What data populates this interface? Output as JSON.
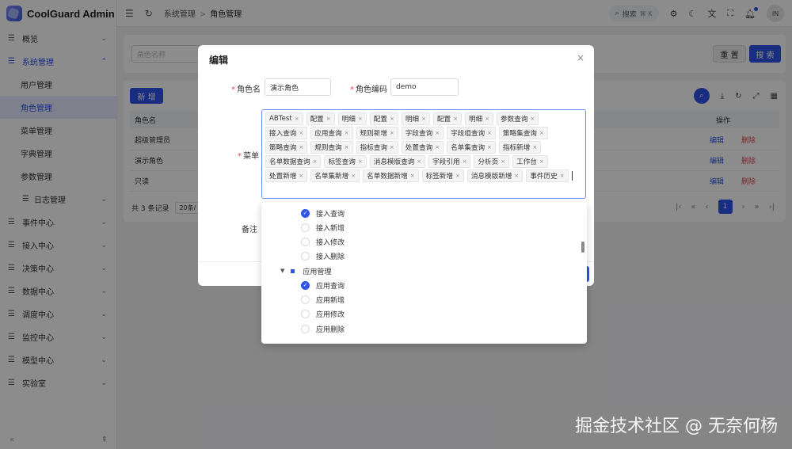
{
  "app": {
    "title": "CoolGuard Admin"
  },
  "sidebar": {
    "items": [
      {
        "label": "概览"
      },
      {
        "label": "系统管理",
        "open": true
      },
      {
        "label": "事件中心"
      },
      {
        "label": "接入中心"
      },
      {
        "label": "决策中心"
      },
      {
        "label": "数据中心"
      },
      {
        "label": "调度中心"
      },
      {
        "label": "监控中心"
      },
      {
        "label": "模型中心"
      },
      {
        "label": "实验室"
      }
    ],
    "sub_items": [
      {
        "label": "用户管理"
      },
      {
        "label": "角色管理",
        "active": true
      },
      {
        "label": "菜单管理"
      },
      {
        "label": "字典管理"
      },
      {
        "label": "参数管理"
      },
      {
        "label": "日志管理"
      }
    ],
    "foot_left": "«",
    "foot_right": "⇞"
  },
  "topbar": {
    "crumb_parent": "系统管理",
    "crumb_sep": ">",
    "crumb_current": "角色管理",
    "search_label": "搜索",
    "search_kbd": "⌘ K",
    "user_initials": "IN"
  },
  "filter": {
    "placeholder": "角色名称",
    "reset_label": "重 置",
    "search_label": "搜 索"
  },
  "table": {
    "add_label": "新 增",
    "col_name": "角色名",
    "col_action": "操作",
    "rows": [
      {
        "name": "超级管理员",
        "edit": "编辑",
        "delete": "删除"
      },
      {
        "name": "演示角色",
        "edit": "编辑",
        "delete": "删除"
      },
      {
        "name": "只读",
        "edit": "编辑",
        "delete": "删除"
      }
    ],
    "total_text": "共 3 条记录",
    "page_size": "20条/",
    "current_page": "1"
  },
  "modal": {
    "title": "编辑",
    "close": "×",
    "role_name_label": "角色名",
    "role_name_value": "演示角色",
    "role_code_label": "角色编码",
    "role_code_value": "demo",
    "menu_label": "菜单",
    "remark_label": "备注",
    "tags": [
      "ABTest",
      "配置",
      "明细",
      "配置",
      "明细",
      "配置",
      "明细",
      "参数查询",
      "接入查询",
      "应用查询",
      "规则新增",
      "字段查询",
      "字段组查询",
      "策略集查询",
      "策略查询",
      "规则查询",
      "指标查询",
      "处置查询",
      "名单集查询",
      "指标新增",
      "名单数据查询",
      "标签查询",
      "消息模版查询",
      "字段引用",
      "分析页",
      "工作台",
      "处置新增",
      "名单集新增",
      "名单数据新增",
      "标签新增",
      "消息模版新增",
      "事件历史"
    ],
    "tag_close": "×"
  },
  "dropdown": {
    "nodes": [
      {
        "label": "接入查询",
        "checked": true,
        "level": 2
      },
      {
        "label": "接入新增",
        "checked": false,
        "level": 2
      },
      {
        "label": "接入修改",
        "checked": false,
        "level": 2
      },
      {
        "label": "接入删除",
        "checked": false,
        "level": 2
      },
      {
        "label": "应用管理",
        "parent": true,
        "level": 1
      },
      {
        "label": "应用查询",
        "checked": true,
        "level": 2
      },
      {
        "label": "应用新增",
        "checked": false,
        "level": 2
      },
      {
        "label": "应用修改",
        "checked": false,
        "level": 2
      },
      {
        "label": "应用删除",
        "checked": false,
        "level": 2
      }
    ]
  },
  "watermark": "掘金技术社区 @ 无奈何杨",
  "colors": {
    "primary": "#2f54eb",
    "danger": "#e5484d"
  }
}
